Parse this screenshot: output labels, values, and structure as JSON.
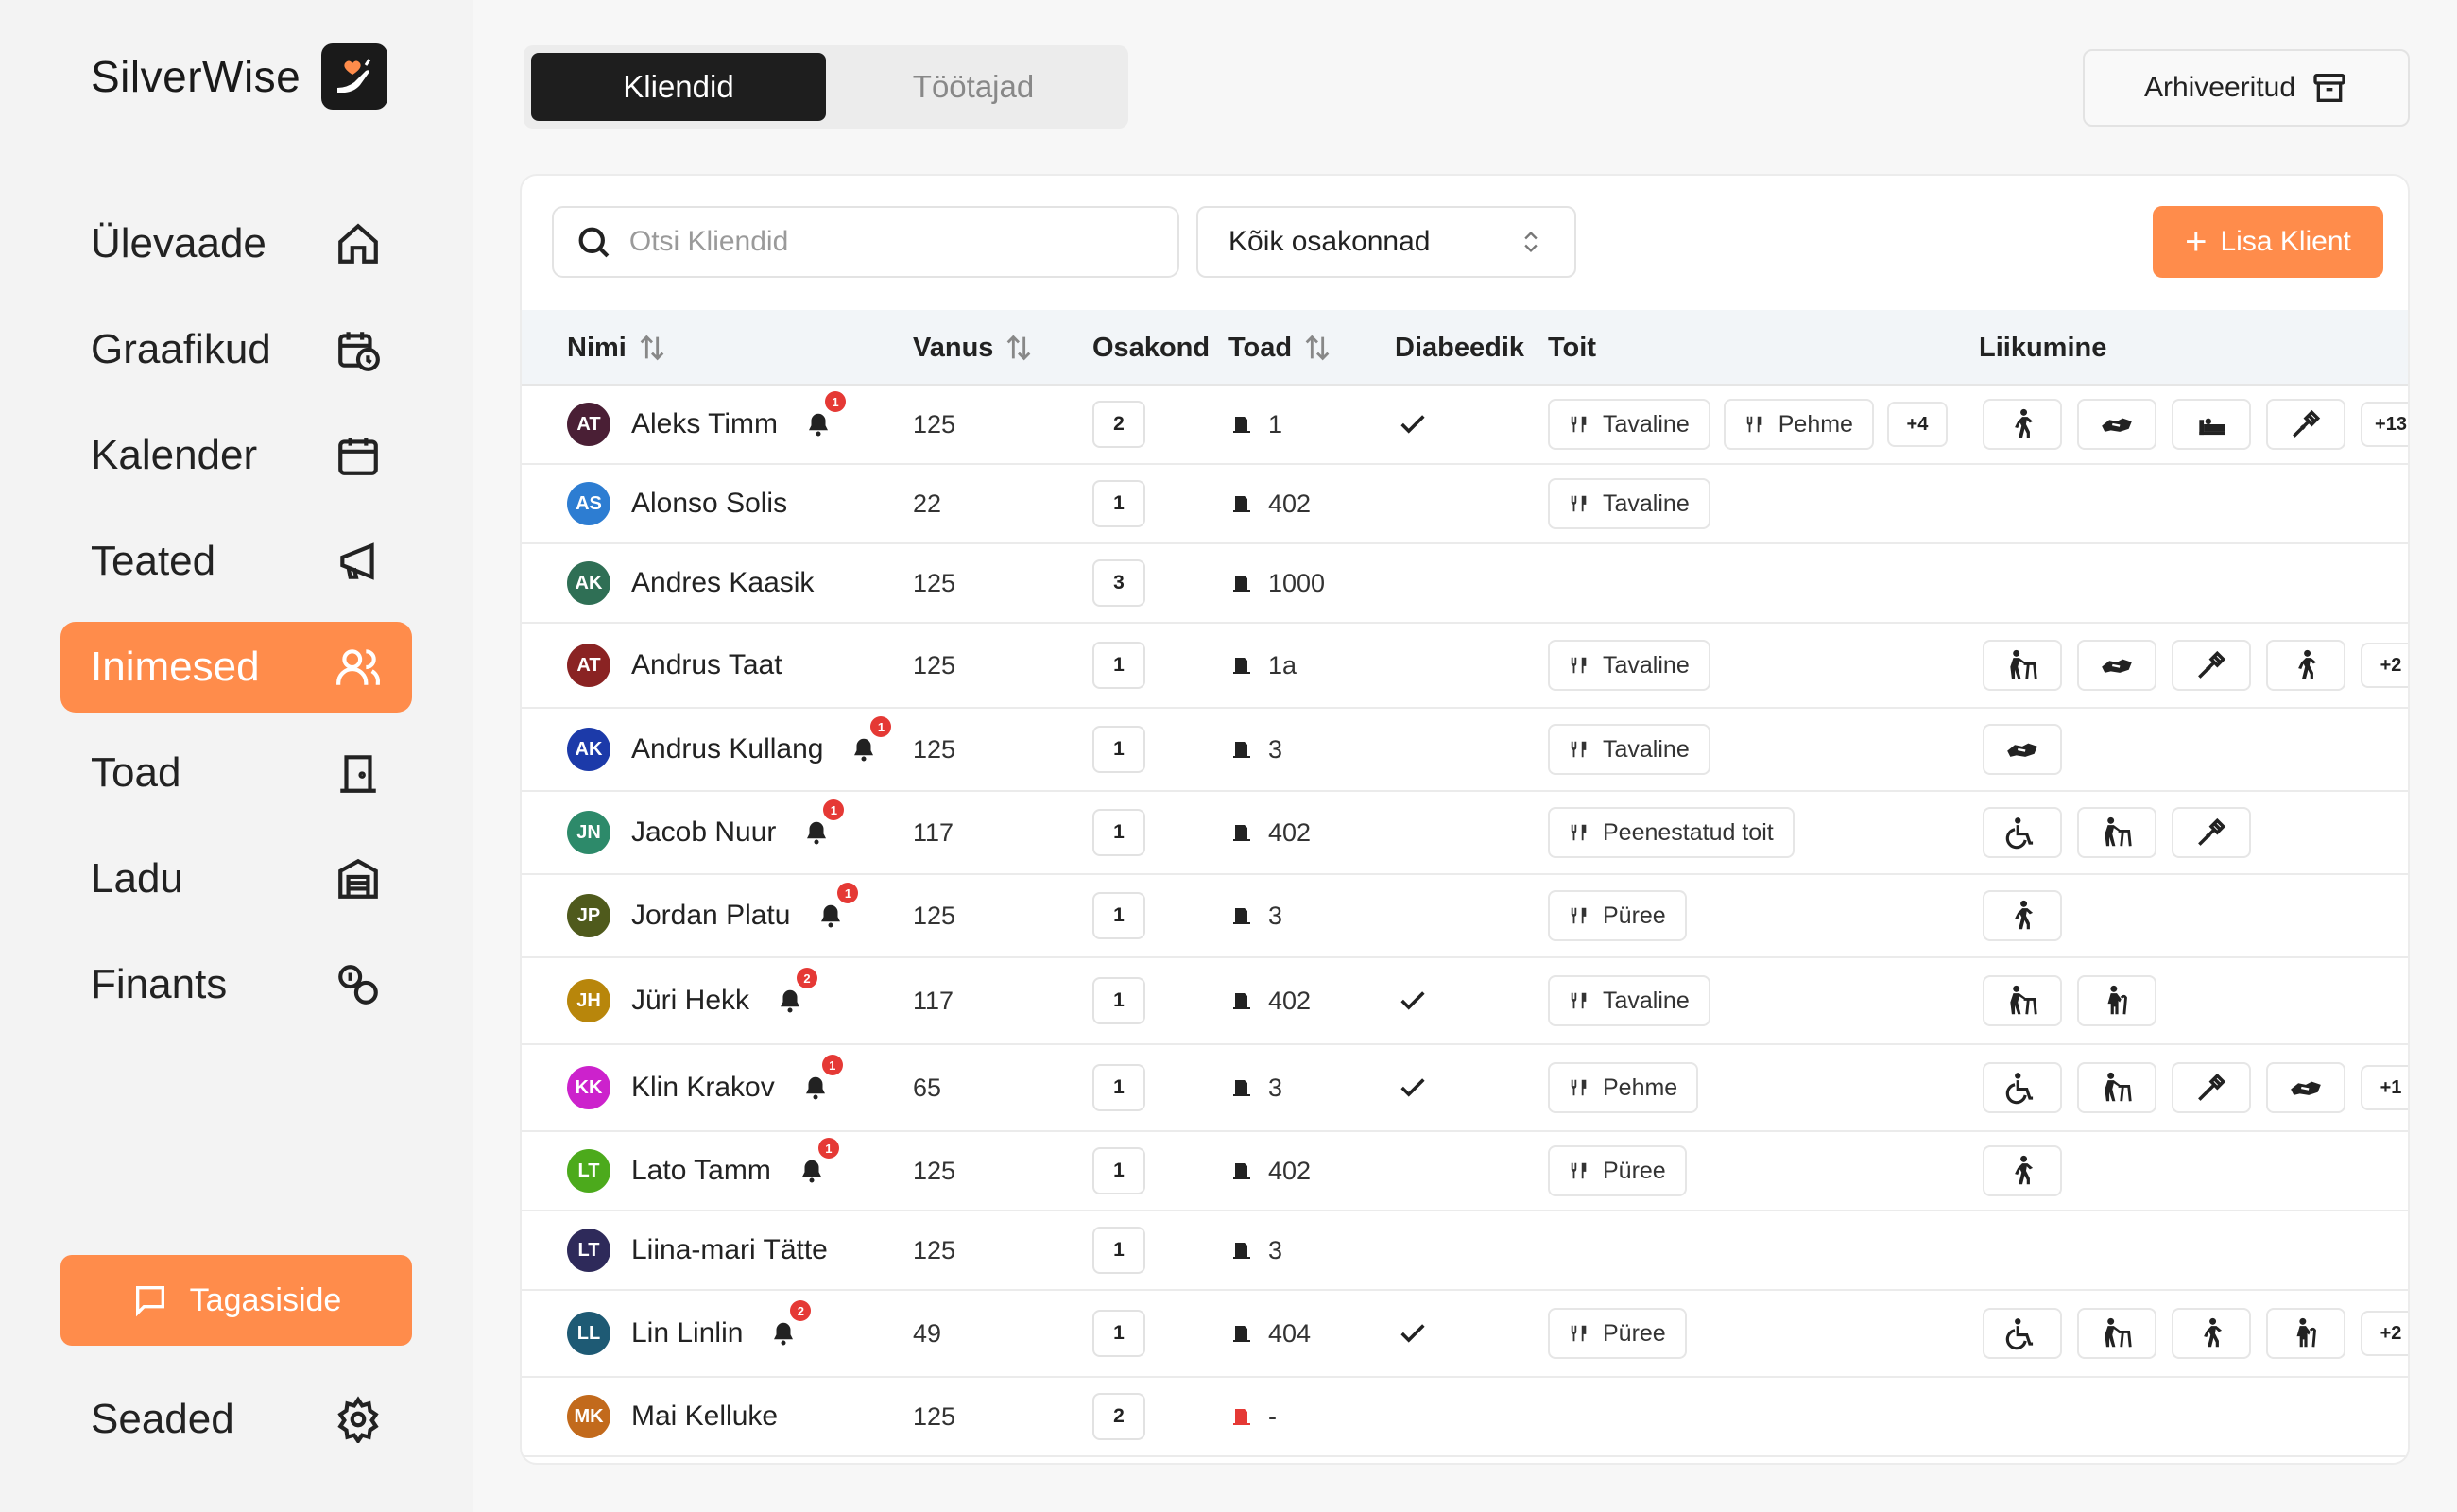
{
  "brand": {
    "name": "SilverWise"
  },
  "nav": [
    {
      "label": "Ülevaade",
      "icon": "home-icon"
    },
    {
      "label": "Graafikud",
      "icon": "calendar-clock-icon"
    },
    {
      "label": "Kalender",
      "icon": "calendar-icon"
    },
    {
      "label": "Teated",
      "icon": "megaphone-icon"
    },
    {
      "label": "Inimesed",
      "icon": "users-icon",
      "active": true
    },
    {
      "label": "Toad",
      "icon": "door-icon"
    },
    {
      "label": "Ladu",
      "icon": "warehouse-icon"
    },
    {
      "label": "Finants",
      "icon": "coins-icon"
    }
  ],
  "feedback": {
    "label": "Tagasiside"
  },
  "settings": {
    "label": "Seaded"
  },
  "tabs": [
    "Kliendid",
    "Töötajad"
  ],
  "archive": {
    "label": "Arhiveeritud"
  },
  "toolbar": {
    "search_placeholder": "Otsi Kliendid",
    "department_filter": "Kõik osakonnad",
    "add_label": "Lisa Klient"
  },
  "columns": {
    "name": "Nimi",
    "age": "Vanus",
    "dept": "Osakond",
    "room": "Toad",
    "diabetic": "Diabeedik",
    "food": "Toit",
    "movement": "Liikumine"
  },
  "colors": {
    "accent": "#ff8c4b",
    "badge": "#e53935"
  },
  "clients": [
    {
      "initials": "AT",
      "color": "#4a1f35",
      "name": "Aleks Timm",
      "alerts": "1",
      "age": "125",
      "dept": "2",
      "room": "1",
      "diabetic": true,
      "food": [
        "Tavaline",
        "Pehme"
      ],
      "food_more": "+4",
      "movement": [
        "walk",
        "assist",
        "bed",
        "crutch"
      ],
      "move_more": "+13"
    },
    {
      "initials": "AS",
      "color": "#2d7dd2",
      "name": "Alonso Solis",
      "alerts": "",
      "age": "22",
      "dept": "1",
      "room": "402",
      "diabetic": false,
      "food": [
        "Tavaline"
      ],
      "food_more": "",
      "movement": [],
      "move_more": ""
    },
    {
      "initials": "AK",
      "color": "#2f6f55",
      "name": "Andres Kaasik",
      "alerts": "",
      "age": "125",
      "dept": "3",
      "room": "1000",
      "diabetic": false,
      "food": [],
      "food_more": "",
      "movement": [],
      "move_more": ""
    },
    {
      "initials": "AT",
      "color": "#8a2323",
      "name": "Andrus Taat",
      "alerts": "",
      "age": "125",
      "dept": "1",
      "room": "1a",
      "diabetic": false,
      "food": [
        "Tavaline"
      ],
      "food_more": "",
      "movement": [
        "walker",
        "assist",
        "crutch",
        "walk"
      ],
      "move_more": "+2"
    },
    {
      "initials": "AK",
      "color": "#1c3aa9",
      "name": "Andrus Kullang",
      "alerts": "1",
      "age": "125",
      "dept": "1",
      "room": "3",
      "diabetic": false,
      "food": [
        "Tavaline"
      ],
      "food_more": "",
      "movement": [
        "assist"
      ],
      "move_more": ""
    },
    {
      "initials": "JN",
      "color": "#2d8a6a",
      "name": "Jacob Nuur",
      "alerts": "1",
      "age": "117",
      "dept": "1",
      "room": "402",
      "diabetic": false,
      "food": [
        "Peenestatud toit"
      ],
      "food_more": "",
      "movement": [
        "wheelchair",
        "walker",
        "crutch"
      ],
      "move_more": ""
    },
    {
      "initials": "JP",
      "color": "#4f5a1c",
      "name": "Jordan Platu",
      "alerts": "1",
      "age": "125",
      "dept": "1",
      "room": "3",
      "diabetic": false,
      "food": [
        "Püree"
      ],
      "food_more": "",
      "movement": [
        "walk"
      ],
      "move_more": ""
    },
    {
      "initials": "JH",
      "color": "#b8860b",
      "name": "Jüri Hekk",
      "alerts": "2",
      "age": "117",
      "dept": "1",
      "room": "402",
      "diabetic": true,
      "food": [
        "Tavaline"
      ],
      "food_more": "",
      "movement": [
        "walker",
        "cane"
      ],
      "move_more": ""
    },
    {
      "initials": "KK",
      "color": "#cc22cc",
      "name": "Klin Krakov",
      "alerts": "1",
      "age": "65",
      "dept": "1",
      "room": "3",
      "diabetic": true,
      "food": [
        "Pehme"
      ],
      "food_more": "",
      "movement": [
        "wheelchair",
        "walker",
        "crutch",
        "assist"
      ],
      "move_more": "+1"
    },
    {
      "initials": "LT",
      "color": "#4caa1c",
      "name": "Lato Tamm",
      "alerts": "1",
      "age": "125",
      "dept": "1",
      "room": "402",
      "diabetic": false,
      "food": [
        "Püree"
      ],
      "food_more": "",
      "movement": [
        "walk"
      ],
      "move_more": ""
    },
    {
      "initials": "LT",
      "color": "#2e2a5a",
      "name": "Liina-mari Tätte",
      "alerts": "",
      "age": "125",
      "dept": "1",
      "room": "3",
      "diabetic": false,
      "food": [],
      "food_more": "",
      "movement": [],
      "move_more": ""
    },
    {
      "initials": "LL",
      "color": "#1e5a74",
      "name": "Lin Linlin",
      "alerts": "2",
      "age": "49",
      "dept": "1",
      "room": "404",
      "diabetic": true,
      "food": [
        "Püree"
      ],
      "food_more": "",
      "movement": [
        "wheelchair",
        "walker",
        "walk",
        "cane"
      ],
      "move_more": "+2"
    },
    {
      "initials": "MK",
      "color": "#c26a1c",
      "name": "Mai Kelluke",
      "alerts": "",
      "age": "125",
      "dept": "2",
      "room": "-",
      "room_alert": true,
      "diabetic": false,
      "food": [],
      "food_more": "",
      "movement": [],
      "move_more": ""
    }
  ]
}
